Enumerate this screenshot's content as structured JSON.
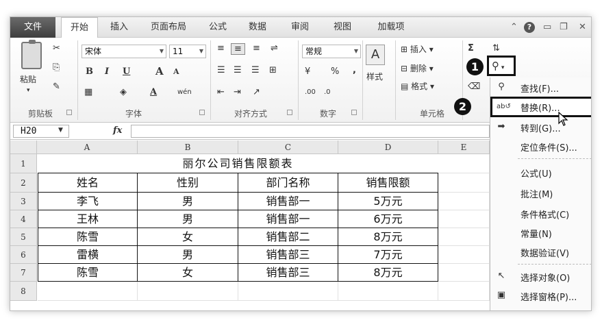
{
  "tabs": [
    {
      "label": "文件"
    },
    {
      "label": "开始"
    },
    {
      "label": "插入"
    },
    {
      "label": "页面布局"
    },
    {
      "label": "公式"
    },
    {
      "label": "数据"
    },
    {
      "label": "审阅"
    },
    {
      "label": "视图"
    },
    {
      "label": "加载项"
    }
  ],
  "ribbon": {
    "clipboard": {
      "paste_label": "粘贴",
      "group_label": "剪贴板"
    },
    "font": {
      "name": "宋体",
      "size": "11",
      "group_label": "字体",
      "bold": "B",
      "italic": "I",
      "underline": "U",
      "grow": "A",
      "shrink": "A",
      "color_a": "A",
      "phonetic": "wén"
    },
    "alignment": {
      "group_label": "对齐方式"
    },
    "number": {
      "format": "常规",
      "percent": "%",
      "comma": ",",
      "group_label": "数字"
    },
    "styles": {
      "label": "样式"
    },
    "cells": {
      "insert": "插入",
      "delete": "删除",
      "format": "格式",
      "group_label": "单元格"
    },
    "editing": {
      "sigma": "Σ"
    }
  },
  "formula_bar": {
    "name_box": "H20",
    "fx": "fx",
    "value": ""
  },
  "columns": [
    "A",
    "B",
    "C",
    "D",
    "E"
  ],
  "rows": [
    "1",
    "2",
    "3",
    "4",
    "5",
    "6",
    "7",
    "8"
  ],
  "sheet": {
    "title": "丽尔公司销售限额表",
    "headers": [
      "姓名",
      "性别",
      "部门名称",
      "销售限额"
    ],
    "data": [
      [
        "李飞",
        "男",
        "销售部一",
        "5万元"
      ],
      [
        "王林",
        "男",
        "销售部一",
        "6万元"
      ],
      [
        "陈雪",
        "女",
        "销售部二",
        "8万元"
      ],
      [
        "雷横",
        "男",
        "销售部三",
        "7万元"
      ],
      [
        "陈雪",
        "女",
        "销售部三",
        "8万元"
      ]
    ]
  },
  "menu": {
    "items": [
      {
        "label": "查找(F)...",
        "icon": "binoculars-icon"
      },
      {
        "label": "替换(R)...",
        "icon": "replace-icon"
      },
      {
        "label": "转到(G)...",
        "icon": "goto-arrow-icon"
      },
      {
        "label": "定位条件(S)...",
        "icon": ""
      },
      {
        "label": "公式(U)",
        "icon": ""
      },
      {
        "label": "批注(M)",
        "icon": ""
      },
      {
        "label": "条件格式(C)",
        "icon": ""
      },
      {
        "label": "常量(N)",
        "icon": ""
      },
      {
        "label": "数据验证(V)",
        "icon": ""
      },
      {
        "label": "选择对象(O)",
        "icon": "pointer-icon"
      },
      {
        "label": "选择窗格(P)...",
        "icon": "selection-pane-icon"
      }
    ]
  },
  "badges": {
    "step1": "1",
    "step2": "2"
  }
}
